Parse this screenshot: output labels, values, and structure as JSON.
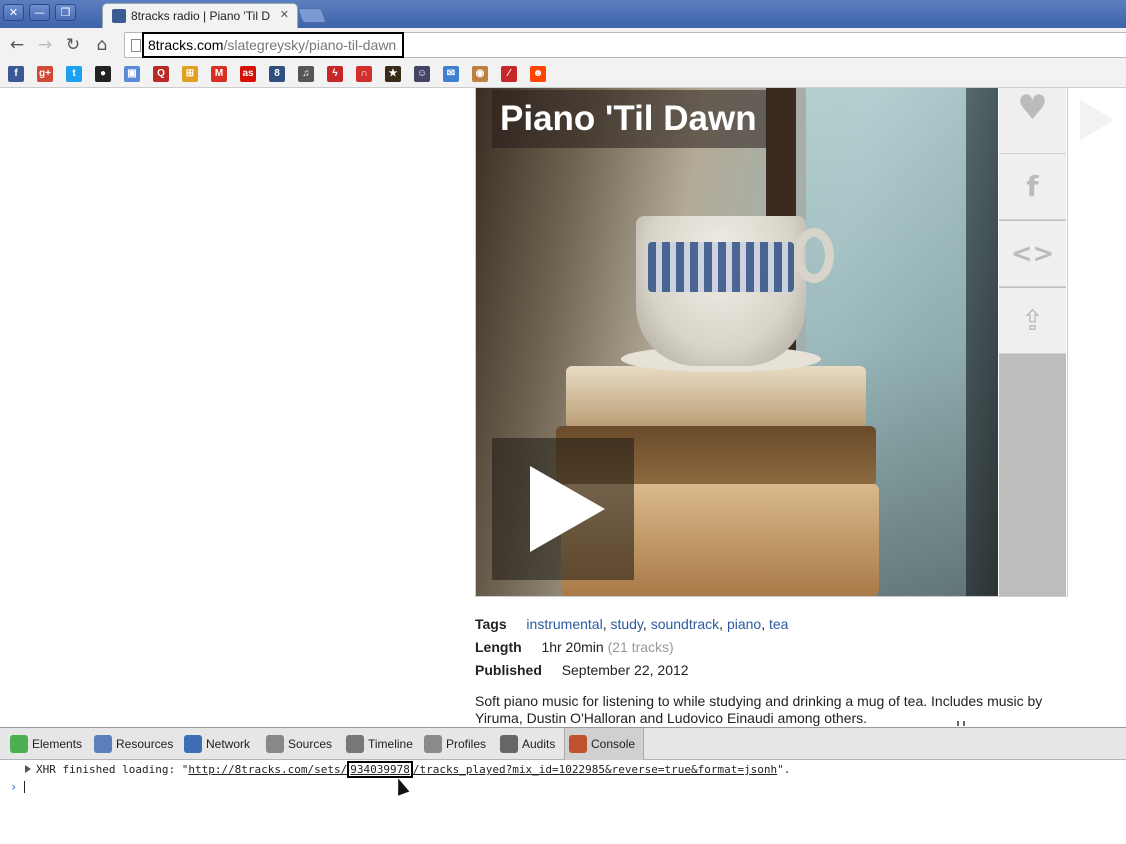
{
  "window": {
    "close_label": "✕",
    "minimize_label": "—",
    "restore_label": "❐"
  },
  "tab": {
    "title": "8tracks radio | Piano 'Til D",
    "close": "✕"
  },
  "nav": {
    "back": "←",
    "forward": "→",
    "reload": "↻",
    "home": "⌂"
  },
  "address": {
    "host": "8tracks.com",
    "path": "/slategreysky/piano-til-dawn"
  },
  "bookmarks": [
    {
      "icon": "facebook-icon",
      "glyph": "f",
      "color": "#3b5998"
    },
    {
      "icon": "google-plus-icon",
      "glyph": "g+",
      "color": "#d34836"
    },
    {
      "icon": "twitter-icon",
      "glyph": "t",
      "color": "#1da1f2"
    },
    {
      "icon": "github-icon",
      "glyph": "●",
      "color": "#222222"
    },
    {
      "icon": "docs-icon",
      "glyph": "▣",
      "color": "#5b8bd6"
    },
    {
      "icon": "quora-icon",
      "glyph": "Q",
      "color": "#b92b27"
    },
    {
      "icon": "windows-icon",
      "glyph": "⊞",
      "color": "#e0a020"
    },
    {
      "icon": "gmail-icon",
      "glyph": "M",
      "color": "#d93025"
    },
    {
      "icon": "lastfm-icon",
      "glyph": "as",
      "color": "#d51007"
    },
    {
      "icon": "8tracks-icon",
      "glyph": "8",
      "color": "#2f4f7f"
    },
    {
      "icon": "itunes-icon",
      "glyph": "♫",
      "color": "#555555"
    },
    {
      "icon": "flame-icon",
      "glyph": "ϟ",
      "color": "#c62828"
    },
    {
      "icon": "arc-icon",
      "glyph": "∩",
      "color": "#d32f2f"
    },
    {
      "icon": "star-icon",
      "glyph": "★",
      "color": "#3a2a1a"
    },
    {
      "icon": "person-icon",
      "glyph": "☺",
      "color": "#444466"
    },
    {
      "icon": "chat-icon",
      "glyph": "✉",
      "color": "#3f7fd0"
    },
    {
      "icon": "spinner-icon",
      "glyph": "◉",
      "color": "#c08040"
    },
    {
      "icon": "slash-icon",
      "glyph": "⁄",
      "color": "#c62828"
    },
    {
      "icon": "reddit-icon",
      "glyph": "☻",
      "color": "#ff4500"
    }
  ],
  "mix": {
    "title": "Piano 'Til Dawn",
    "tags_label": "Tags",
    "tags": [
      "instrumental",
      "study",
      "soundtrack",
      "piano",
      "tea"
    ],
    "tag_separator": ", ",
    "length_label": "Length",
    "length_value": "1hr 20min",
    "track_count": "(21 tracks)",
    "published_label": "Published",
    "published_value": "September 22, 2012",
    "description": "Soft piano music for listening to while studying and drinking a mug of tea. Includes music by Yiruma, Dustin O'Halloran and Ludovico Einaudi among others."
  },
  "side_actions": [
    {
      "name": "like-button",
      "icon": "heart-icon",
      "glyph": "♥"
    },
    {
      "name": "facebook-share-button",
      "icon": "facebook-icon",
      "glyph": "f"
    },
    {
      "name": "embed-button",
      "icon": "code-icon",
      "glyph": "<>"
    },
    {
      "name": "share-button",
      "icon": "share-icon",
      "glyph": "⇪"
    }
  ],
  "devtools": {
    "tabs": [
      "Elements",
      "Resources",
      "Network",
      "Sources",
      "Timeline",
      "Profiles",
      "Audits",
      "Console"
    ],
    "active_tab": "Console",
    "log_prefix": "XHR finished loading: \"",
    "log_url_start": "http://8tracks.com/sets/",
    "log_url_highlight": "934039978",
    "log_url_end": "/tracks_played?mix_id=1022985&reverse=true&format=jsonh",
    "log_suffix": "\".",
    "prompt": "›"
  }
}
